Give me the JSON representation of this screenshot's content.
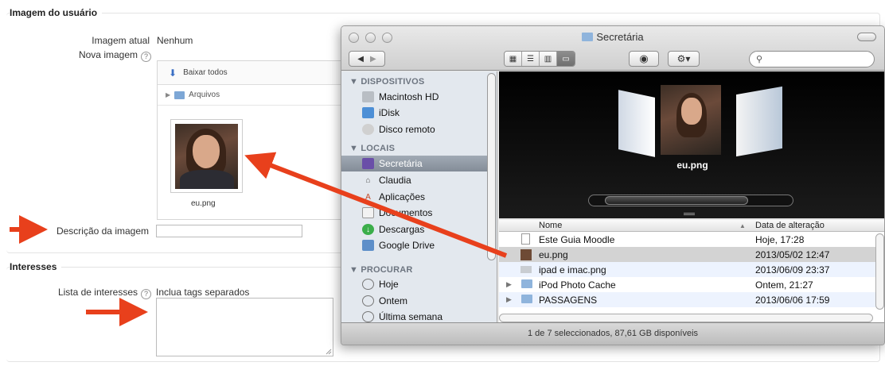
{
  "profile": {
    "legend": "Imagem do usuário",
    "current_label": "Imagem atual",
    "current_value": "Nenhum",
    "new_label": "Nova imagem",
    "help": "?",
    "download_all": "Baixar todos",
    "folder": "Arquivos",
    "file_name": "eu.png",
    "desc_label": "Descrição da imagem",
    "desc_value": ""
  },
  "interests": {
    "legend": "Interesses",
    "list_label": "Lista de interesses",
    "hint": "Inclua tags separados"
  },
  "finder": {
    "title": "Secretária",
    "search_placeholder": "",
    "sections": [
      {
        "label": "▼ DISPOSITIVOS",
        "items": [
          {
            "label": "Macintosh HD",
            "icon": "hard-drive-icon"
          },
          {
            "label": "iDisk",
            "icon": "idisk-icon"
          },
          {
            "label": "Disco remoto",
            "icon": "remote-disc-icon"
          }
        ]
      },
      {
        "label": "▼ LOCAIS",
        "items": [
          {
            "label": "Secretária",
            "icon": "desktop-icon"
          },
          {
            "label": "Claudia",
            "icon": "home-icon"
          },
          {
            "label": "Aplicações",
            "icon": "applications-icon"
          },
          {
            "label": "Documentos",
            "icon": "documents-icon"
          },
          {
            "label": "Descargas",
            "icon": "downloads-icon"
          },
          {
            "label": "Google Drive",
            "icon": "google-drive-icon"
          }
        ]
      },
      {
        "label": "▼ PROCURAR",
        "items": [
          {
            "label": "Hoje",
            "icon": "clock-icon"
          },
          {
            "label": "Ontem",
            "icon": "clock-icon"
          },
          {
            "label": "Última semana",
            "icon": "clock-icon"
          }
        ]
      }
    ],
    "coverflow_label": "eu.png",
    "columns": {
      "name": "Nome",
      "date": "Data de alteração"
    },
    "files": [
      {
        "name": "Este Guia Moodle",
        "date": "Hoje, 17:28",
        "kind": "doc"
      },
      {
        "name": "eu.png",
        "date": "2013/05/02 12:47",
        "kind": "image"
      },
      {
        "name": "ipad e imac.png",
        "date": "2013/06/09 23:37",
        "kind": "image"
      },
      {
        "name": "iPod Photo Cache",
        "date": "Ontem, 21:27",
        "kind": "folder"
      },
      {
        "name": "PASSAGENS",
        "date": "2013/06/06 17:59",
        "kind": "folder"
      }
    ],
    "status": "1 de 7 seleccionados, 87,61 GB disponíveis"
  },
  "colors": {
    "arrow": "#e8401c",
    "finder_selection": "#8a93a0"
  }
}
